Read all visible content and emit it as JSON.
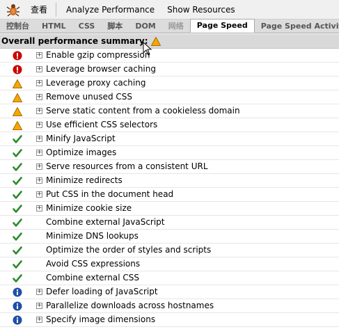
{
  "toolbar": {
    "firebug_icon": "firebug-bug-icon",
    "inspect_label": "查看",
    "analyze_label": "Analyze Performance",
    "resources_label": "Show Resources"
  },
  "tabs": [
    {
      "label": "控制台",
      "state": "normal"
    },
    {
      "label": "HTML",
      "state": "normal"
    },
    {
      "label": "CSS",
      "state": "normal"
    },
    {
      "label": "脚本",
      "state": "normal"
    },
    {
      "label": "DOM",
      "state": "normal"
    },
    {
      "label": "网络",
      "state": "dim"
    },
    {
      "label": "Page Speed",
      "state": "active"
    },
    {
      "label": "Page Speed Activity",
      "state": "normal"
    }
  ],
  "summary": {
    "label": "Overall performance summary:",
    "status": "warning"
  },
  "colors": {
    "error": "#cc0000",
    "warning": "#f5a800",
    "pass": "#2e8b2e",
    "info": "#1f4fa8"
  },
  "rules": [
    {
      "label": "Enable gzip compression",
      "status": "error",
      "expandable": true
    },
    {
      "label": "Leverage browser caching",
      "status": "error",
      "expandable": true
    },
    {
      "label": "Leverage proxy caching",
      "status": "warning",
      "expandable": true
    },
    {
      "label": "Remove unused CSS",
      "status": "warning",
      "expandable": true
    },
    {
      "label": "Serve static content from a cookieless domain",
      "status": "warning",
      "expandable": true
    },
    {
      "label": "Use efficient CSS selectors",
      "status": "warning",
      "expandable": true
    },
    {
      "label": "Minify JavaScript",
      "status": "pass",
      "expandable": true
    },
    {
      "label": "Optimize images",
      "status": "pass",
      "expandable": true
    },
    {
      "label": "Serve resources from a consistent URL",
      "status": "pass",
      "expandable": true
    },
    {
      "label": "Minimize redirects",
      "status": "pass",
      "expandable": true
    },
    {
      "label": "Put CSS in the document head",
      "status": "pass",
      "expandable": true
    },
    {
      "label": "Minimize cookie size",
      "status": "pass",
      "expandable": true
    },
    {
      "label": "Combine external JavaScript",
      "status": "pass",
      "expandable": false
    },
    {
      "label": "Minimize DNS lookups",
      "status": "pass",
      "expandable": false
    },
    {
      "label": "Optimize the order of styles and scripts",
      "status": "pass",
      "expandable": false
    },
    {
      "label": "Avoid CSS expressions",
      "status": "pass",
      "expandable": false
    },
    {
      "label": "Combine external CSS",
      "status": "pass",
      "expandable": false
    },
    {
      "label": "Defer loading of JavaScript",
      "status": "info",
      "expandable": true
    },
    {
      "label": "Parallelize downloads across hostnames",
      "status": "info",
      "expandable": true
    },
    {
      "label": "Specify image dimensions",
      "status": "info",
      "expandable": true
    }
  ]
}
